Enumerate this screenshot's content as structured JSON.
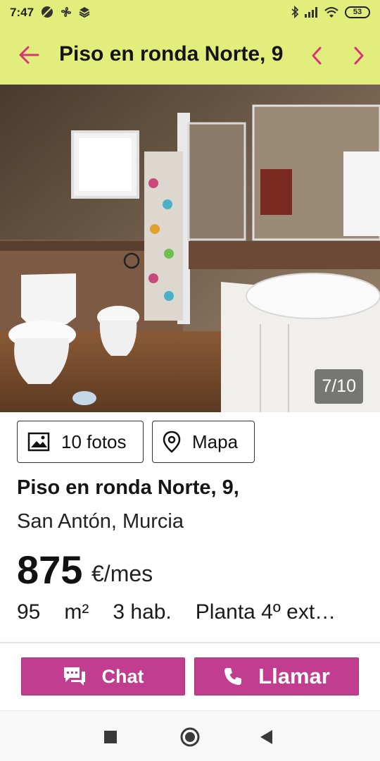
{
  "status_bar": {
    "time": "7:47",
    "battery": "53"
  },
  "app_bar": {
    "title": "Piso en ronda Norte, 9",
    "accent_color": "#d6357a",
    "background_color": "#e2ee7c",
    "back_icon": "arrow-left-icon",
    "prev_icon": "chevron-left-icon",
    "next_icon": "chevron-right-icon"
  },
  "gallery": {
    "counter": "7/10"
  },
  "chips": [
    {
      "label": "10 fotos",
      "icon": "image-icon"
    },
    {
      "label": "Mapa",
      "icon": "location-pin-icon"
    }
  ],
  "listing": {
    "title": "Piso en ronda Norte, 9,",
    "location": "San Antón, Murcia",
    "price": "875",
    "price_unit": "€/mes",
    "features": [
      "95",
      "m²",
      "3 hab.",
      "Planta 4º ext…"
    ]
  },
  "actions": {
    "chat_label": "Chat",
    "call_label": "Llamar",
    "button_color": "#c13d8f"
  },
  "nav": {
    "icons": [
      "recents-square-icon",
      "home-circle-icon",
      "back-triangle-icon"
    ]
  }
}
